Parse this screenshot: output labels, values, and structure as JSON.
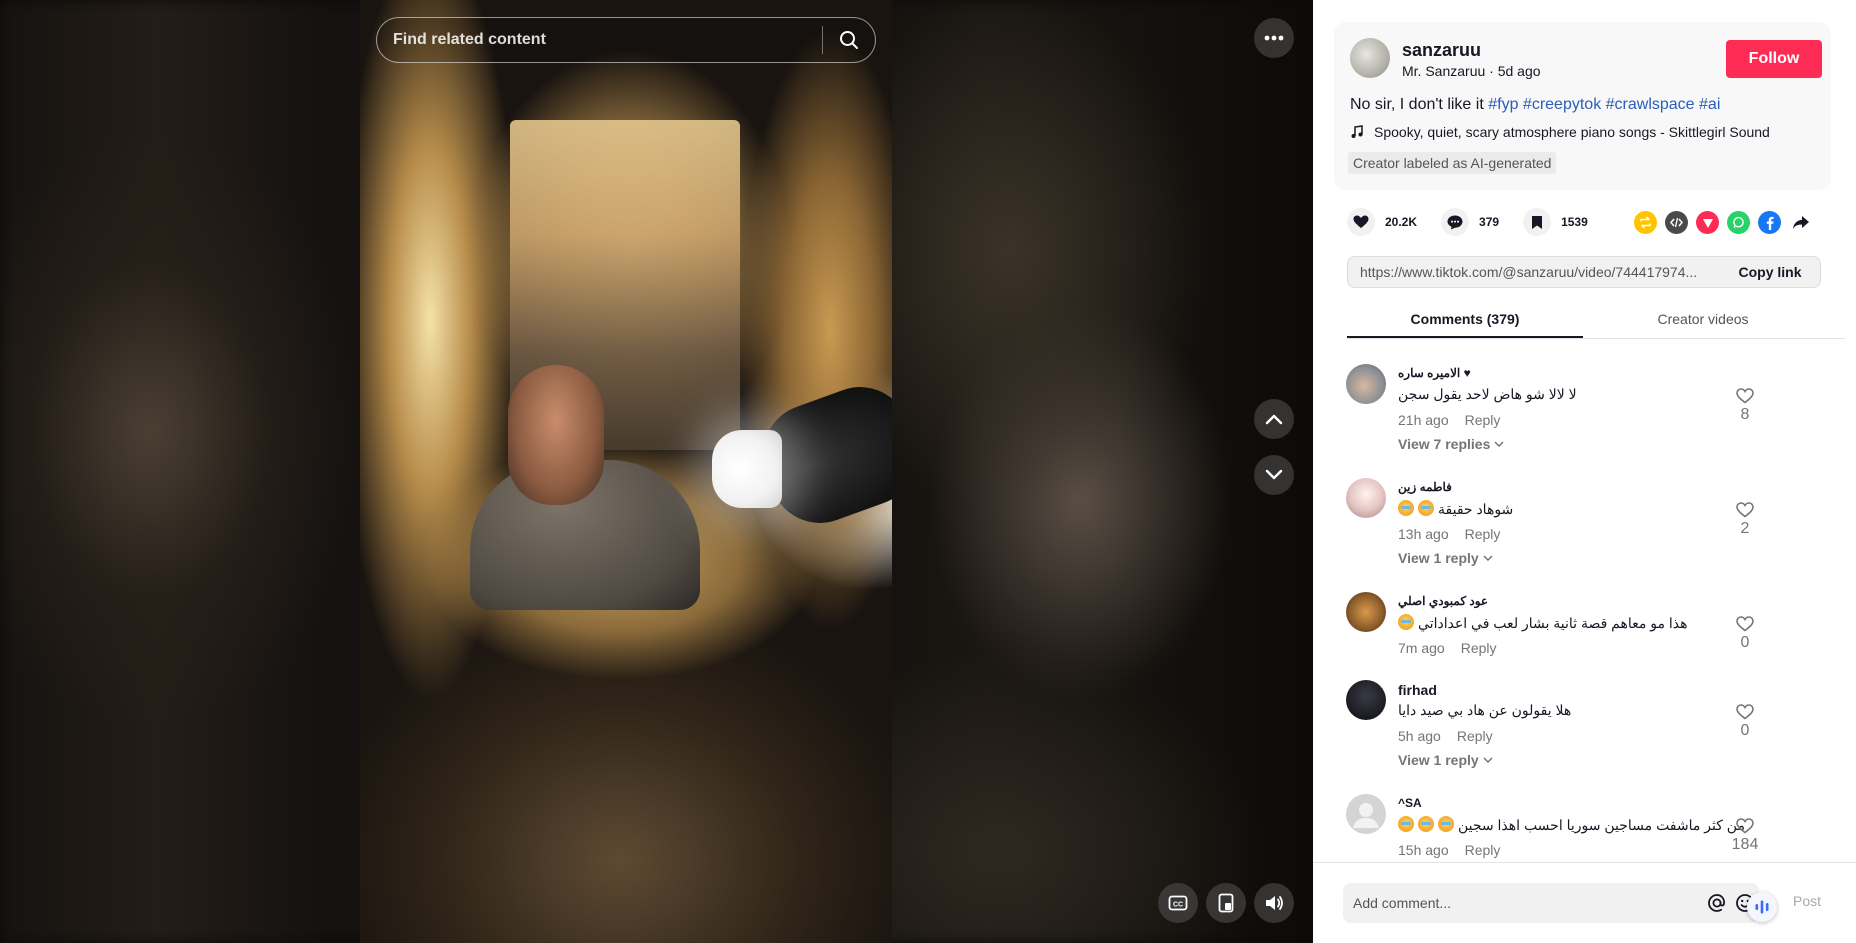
{
  "search": {
    "placeholder": "Find related content"
  },
  "author": {
    "username": "sanzaruu",
    "subtitle": "Mr. Sanzaruu · 5d ago",
    "follow_label": "Follow"
  },
  "caption": {
    "text": "No sir, I don't like it ",
    "hashtags": [
      "#fyp",
      "#creepytok",
      "#crawlspace",
      "#ai"
    ]
  },
  "music": {
    "title": "Spooky, quiet, scary atmosphere piano songs - Skittlegirl Sound"
  },
  "ai_label": "Creator labeled as AI-generated",
  "stats": {
    "likes": "20.2K",
    "comments": "379",
    "saves": "1539"
  },
  "share": {
    "icons": [
      "repost-icon",
      "embed-icon",
      "send-icon",
      "whatsapp-icon",
      "facebook-icon",
      "share-arrow-icon"
    ],
    "colors": {
      "repost": "#ffc300",
      "embed": "#4a4a4a",
      "send": "#fe2c55",
      "whatsapp": "#25d366",
      "facebook": "#1877f2"
    }
  },
  "link": {
    "url": "https://www.tiktok.com/@sanzaruu/video/744417974...",
    "copy_label": "Copy link"
  },
  "tabs": [
    {
      "label": "Comments (379)",
      "active": true
    },
    {
      "label": "Creator videos",
      "active": false
    }
  ],
  "comments": [
    {
      "name": "الاميره ساره ♥",
      "text": "لا لالا شو هاض لاحد يقول سجن",
      "time": "21h ago",
      "reply": "Reply",
      "likes": "8",
      "view_replies": "View 7 replies",
      "avatar_color": "#8a8f94"
    },
    {
      "name": "فاطمه زين",
      "text": "شوهاد حقيقة",
      "emojis": 2,
      "time": "13h ago",
      "reply": "Reply",
      "likes": "2",
      "view_replies": "View 1 reply",
      "avatar_color": "#d9b8b8"
    },
    {
      "name": "عود كمبودي اصلي",
      "text": "هذا مو معاهم قصة ثانية بشار لعب في اعداداتي",
      "emojis": 1,
      "time": "7m ago",
      "reply": "Reply",
      "likes": "0",
      "view_replies": "",
      "avatar_color": "#b07a3a"
    },
    {
      "name": "firhad",
      "text": "هلا يقولون عن هاد بي صيد دايا",
      "time": "5h ago",
      "reply": "Reply",
      "likes": "0",
      "view_replies": "View 1 reply",
      "avatar_color": "#2a2a30"
    },
    {
      "name": "^SA",
      "text": "من كثر ماشفت مساجين سوريا احسب اهذا سجين",
      "emojis": 3,
      "time": "15h ago",
      "reply": "Reply",
      "likes": "184",
      "view_replies": "",
      "avatar_color": "#d4d4d4"
    }
  ],
  "comment_bar": {
    "placeholder": "Add comment...",
    "post_label": "Post"
  }
}
